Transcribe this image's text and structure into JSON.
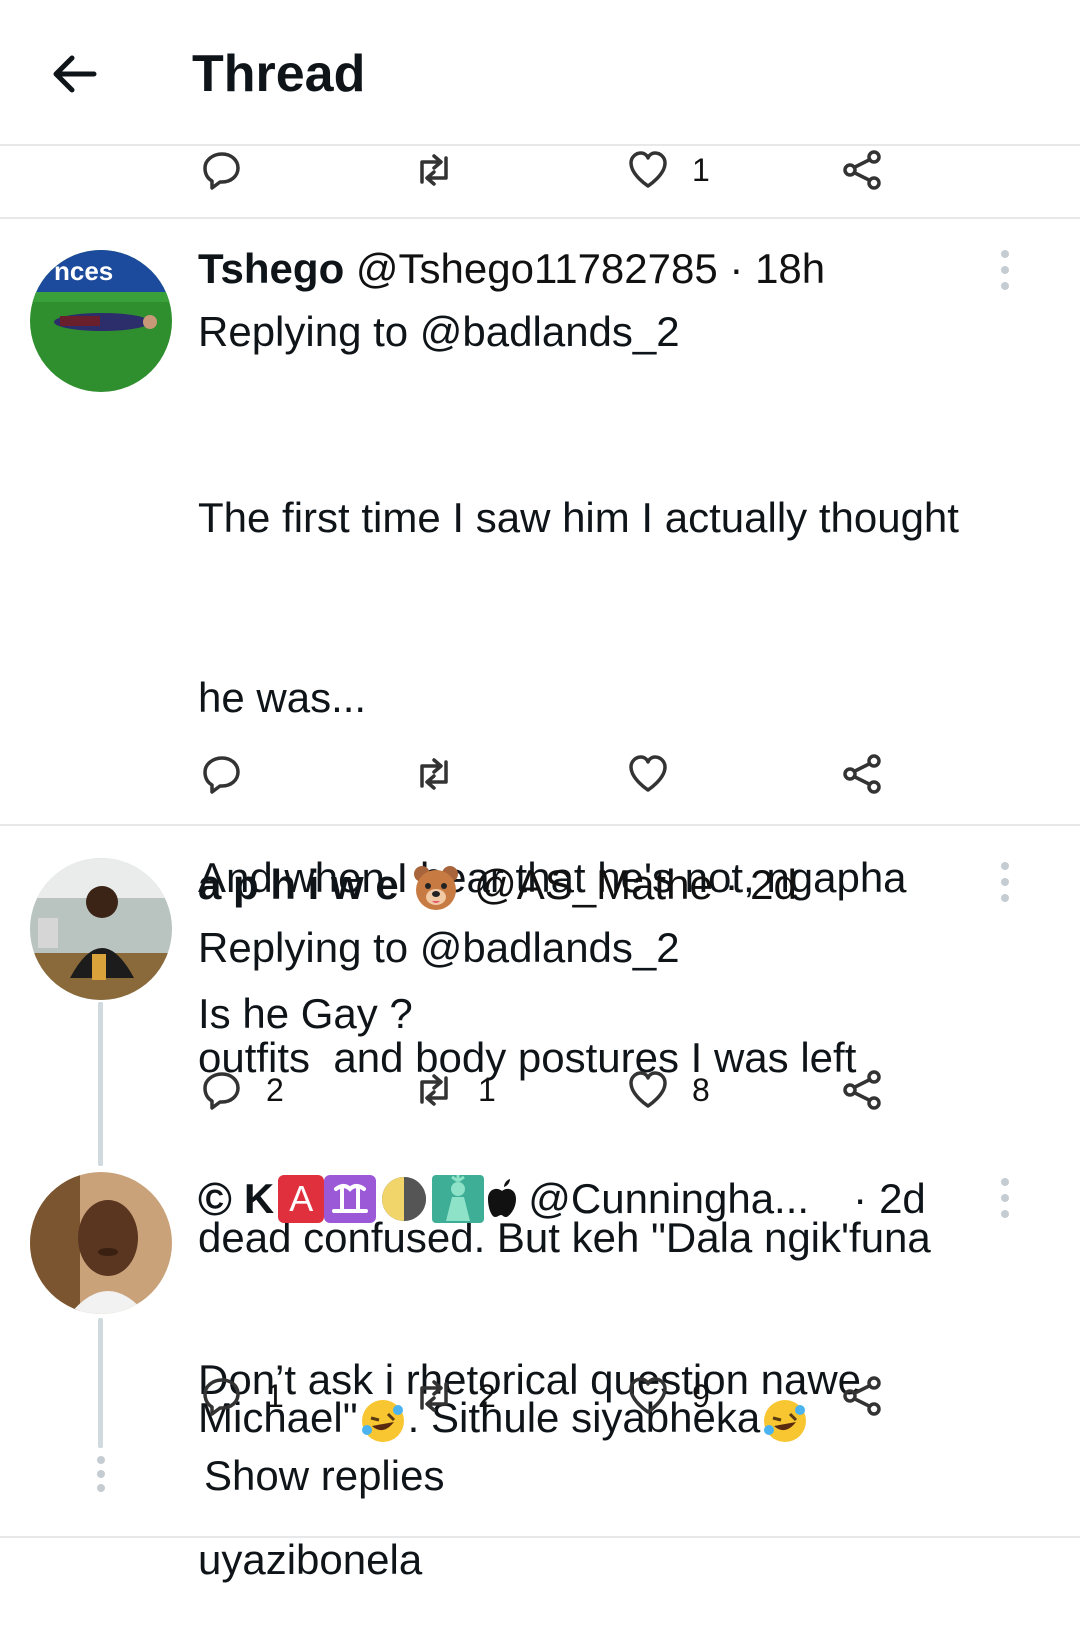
{
  "header": {
    "title": "Thread",
    "back_icon": "arrow-left-icon"
  },
  "top_actions": {
    "reply": "",
    "retweet": "",
    "like": "1",
    "share": ""
  },
  "tweets": [
    {
      "name": "Tshego",
      "handle": "@Tshego11782785",
      "sep": "·",
      "time": "18h",
      "replying": "Replying to @badlands_2",
      "text_lines": [
        "The first time I saw him I actually thought",
        "he was...",
        "And when I hear that he's not, ngapha",
        "outfits  and body postures I was left",
        "dead confused. But keh \"Dala ngik'funa",
        "Michael\"",
        ". Sithule siyabheka"
      ],
      "avatar_text": "nces",
      "replies": "",
      "retweets": "",
      "likes": ""
    },
    {
      "name": "a p h i w e",
      "handle": "@AS_Mathe",
      "sep": "·",
      "time": "2d",
      "replying": "Replying to @badlands_2",
      "text": "Is he Gay ?",
      "replies": "2",
      "retweets": "1",
      "likes": "8"
    },
    {
      "name_prefix": "©",
      "name_k": "K",
      "name_a": "A",
      "handle": "@Cunningha...",
      "sep": "·",
      "time": "2d",
      "text_lines": [
        "Don’t ask i rhetorical question nawe",
        "uyazibonela"
      ],
      "replies": "1",
      "retweets": "2",
      "likes": "9"
    }
  ],
  "show_replies": "Show replies",
  "colors": {
    "text": "#0f1419",
    "divider": "#e6e8ea",
    "thread_line": "#cfd9de"
  },
  "icons": [
    "reply-icon",
    "retweet-icon",
    "heart-icon",
    "share-icon",
    "more-icon",
    "laughing-emoji-icon",
    "bear-emoji-icon"
  ]
}
